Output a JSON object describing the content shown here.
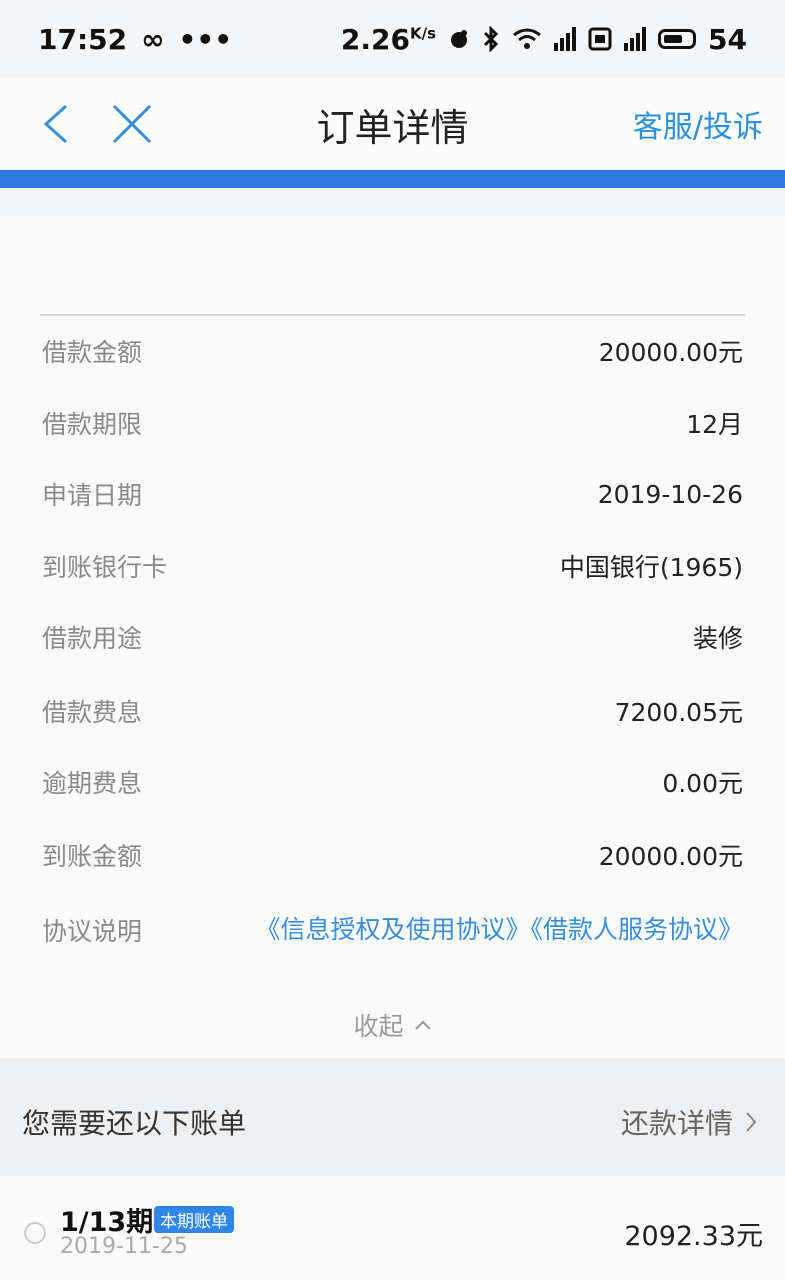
{
  "status_bar": {
    "time": "17:52",
    "infinity": "∞",
    "dots": "•••",
    "speed": "2.26",
    "speed_unit": "K/s",
    "battery": "54"
  },
  "nav": {
    "title": "订单详情",
    "service_link": "客服/投诉"
  },
  "details": [
    {
      "label": "借款金额",
      "value": "20000.00元"
    },
    {
      "label": "借款期限",
      "value": "12月"
    },
    {
      "label": "申请日期",
      "value": "2019-10-26"
    },
    {
      "label": "到账银行卡",
      "value": "中国银行(1965)"
    },
    {
      "label": "借款用途",
      "value": "装修"
    },
    {
      "label": "借款费息",
      "value": "7200.05元"
    },
    {
      "label": "逾期费息",
      "value": "0.00元"
    },
    {
      "label": "到账金额",
      "value": "20000.00元"
    }
  ],
  "agreement": {
    "label": "协议说明",
    "link1": "《信息授权及使用协议》",
    "link2": "《借款人服务协议》"
  },
  "collapse_label": "收起",
  "bills": {
    "title": "您需要还以下账单",
    "detail_link": "还款详情",
    "items": [
      {
        "period": "1/13期",
        "badge": "本期账单",
        "date": "2019-11-25",
        "amount": "2092.33元"
      }
    ]
  }
}
